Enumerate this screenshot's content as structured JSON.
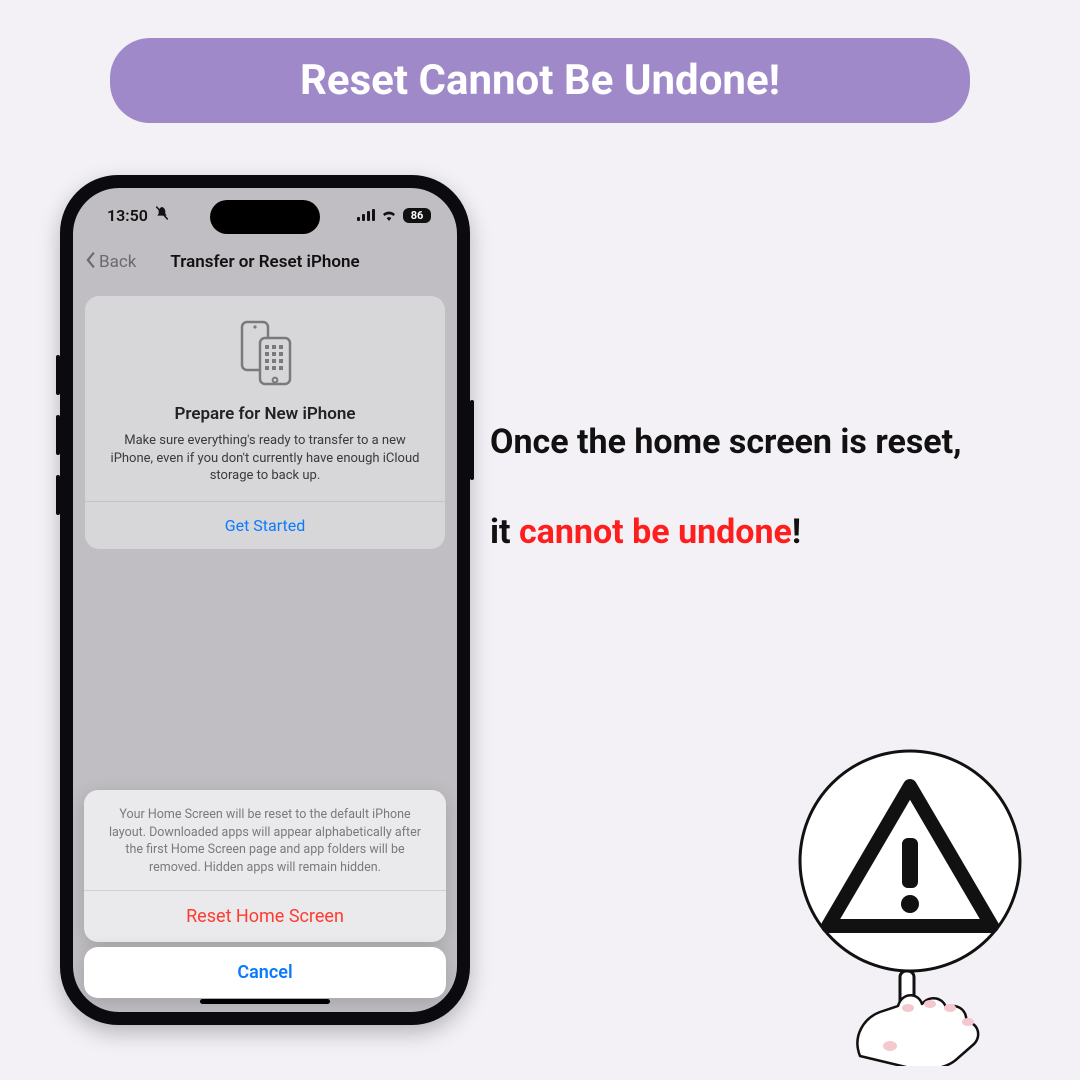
{
  "banner": {
    "title": "Reset Cannot Be Undone!"
  },
  "status": {
    "time": "13:50",
    "battery": "86"
  },
  "nav": {
    "back": "Back",
    "title": "Transfer or Reset iPhone"
  },
  "prepare": {
    "heading": "Prepare for New iPhone",
    "body": "Make sure everything's ready to transfer to a new iPhone, even if you don't currently have enough iCloud storage to back up.",
    "cta": "Get Started"
  },
  "sheet": {
    "message": "Your Home Screen will be reset to the default iPhone layout. Downloaded apps will appear alphabetically after the first Home Screen page and app folders will be removed. Hidden apps will remain hidden.",
    "destructive": "Reset Home Screen",
    "cancel": "Cancel"
  },
  "copy": {
    "line1": "Once the home screen is reset,",
    "line2_prefix": "it ",
    "line2_emph": "cannot be undone",
    "line2_suffix": "!"
  }
}
